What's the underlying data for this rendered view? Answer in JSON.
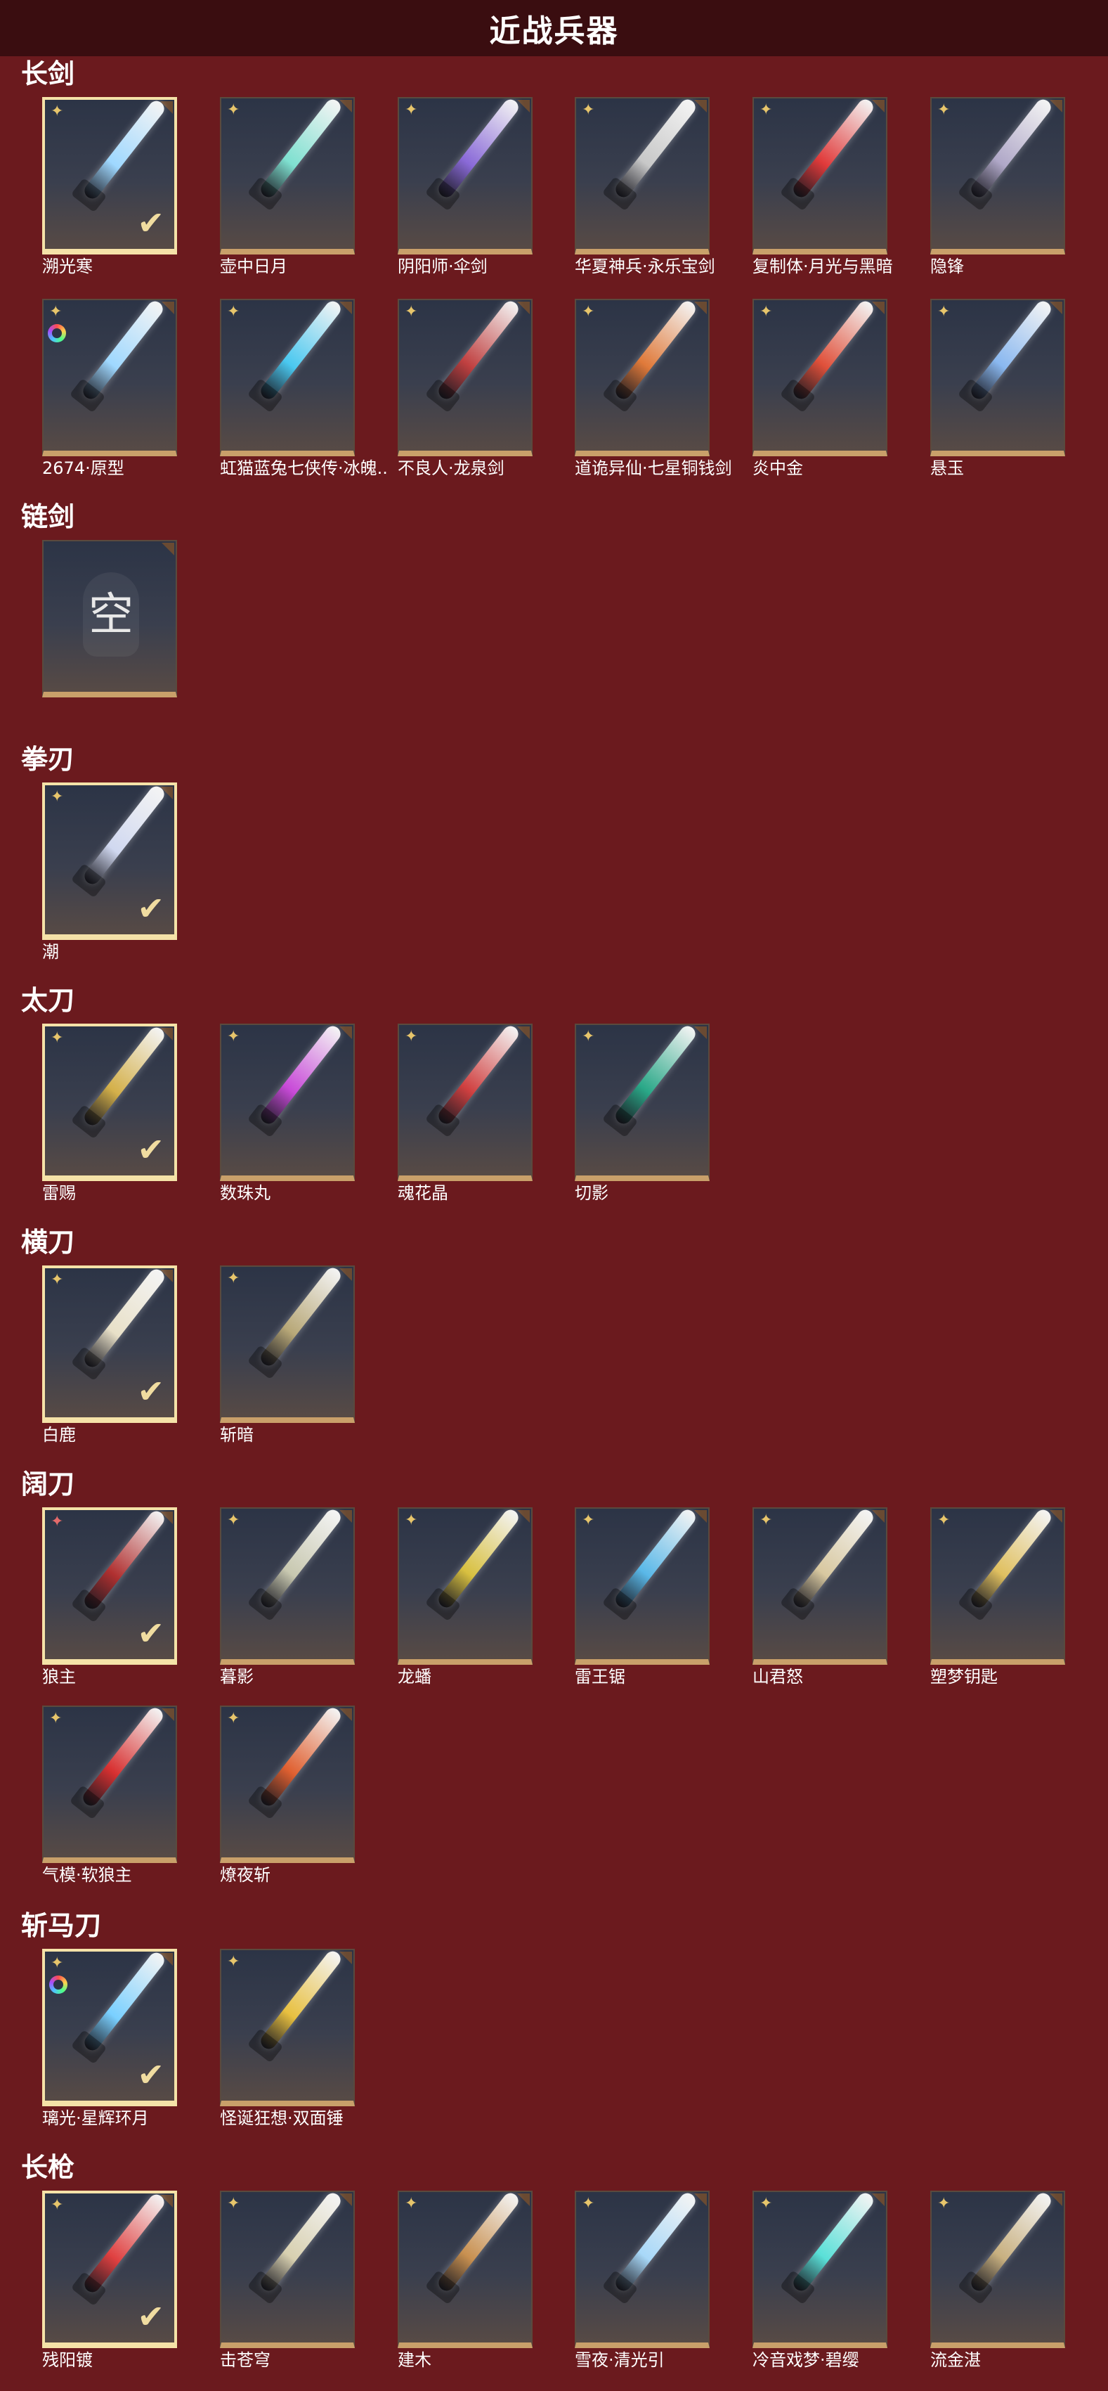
{
  "page_title": "近战兵器",
  "categories": [
    {
      "label": "长剑",
      "items": [
        {
          "name": "溯光寒",
          "selected": true,
          "marker": "star",
          "color": "#9fd8ff"
        },
        {
          "name": "壶中日月",
          "selected": false,
          "marker": "star",
          "color": "#7fe0d0"
        },
        {
          "name": "阴阳师·伞剑",
          "selected": false,
          "marker": "star",
          "color": "#8a6ad8"
        },
        {
          "name": "华夏神兵·永乐宝剑",
          "selected": false,
          "marker": "star",
          "color": "#c8c8c8"
        },
        {
          "name": "复制体·月光与黑暗",
          "selected": false,
          "marker": "star",
          "color": "#e03a3a"
        },
        {
          "name": "隐锋",
          "selected": false,
          "marker": "star",
          "color": "#b0a8c8"
        },
        {
          "name": "2674·原型",
          "selected": false,
          "marker": "star",
          "color": "#9fd8ff",
          "ring": true
        },
        {
          "name": "虹猫蓝兔七侠传·冰魄...",
          "selected": false,
          "marker": "star",
          "color": "#4ac8f0"
        },
        {
          "name": "不良人·龙泉剑",
          "selected": false,
          "marker": "star",
          "color": "#c04040"
        },
        {
          "name": "道诡异仙·七星铜钱剑",
          "selected": false,
          "marker": "star",
          "color": "#e07a3a"
        },
        {
          "name": "炎中金",
          "selected": false,
          "marker": "star",
          "color": "#e0503a"
        },
        {
          "name": "悬玉",
          "selected": false,
          "marker": "star",
          "color": "#8ab8f0"
        }
      ]
    },
    {
      "label": "链剑",
      "items": [
        {
          "name": "",
          "empty": true,
          "glyph": "空"
        }
      ]
    },
    {
      "label": "拳刃",
      "items": [
        {
          "name": "潮",
          "selected": true,
          "marker": "star",
          "color": "#d0d8f0"
        }
      ]
    },
    {
      "label": "太刀",
      "items": [
        {
          "name": "雷赐",
          "selected": true,
          "marker": "star",
          "color": "#d4b04a"
        },
        {
          "name": "数珠丸",
          "selected": false,
          "marker": "star",
          "color": "#c84ad8"
        },
        {
          "name": "魂花晶",
          "selected": false,
          "marker": "star",
          "color": "#d04040"
        },
        {
          "name": "切影",
          "selected": false,
          "marker": "star",
          "color": "#2aa888"
        }
      ]
    },
    {
      "label": "横刀",
      "items": [
        {
          "name": "白鹿",
          "selected": true,
          "marker": "star",
          "color": "#e8e0c8"
        },
        {
          "name": "斩暗",
          "selected": false,
          "marker": "star",
          "color": "#b8a878"
        }
      ]
    },
    {
      "label": "阔刀",
      "items": [
        {
          "name": "狼主",
          "selected": true,
          "marker": "star-red",
          "color": "#b03030"
        },
        {
          "name": "暮影",
          "selected": false,
          "marker": "star",
          "color": "#c8c8b0"
        },
        {
          "name": "龙蟠",
          "selected": false,
          "marker": "star",
          "color": "#d8c040"
        },
        {
          "name": "雷王锯",
          "selected": false,
          "marker": "star",
          "color": "#5ab8e8"
        },
        {
          "name": "山君怒",
          "selected": false,
          "marker": "star",
          "color": "#d8c8a0"
        },
        {
          "name": "塑梦钥匙",
          "selected": false,
          "marker": "star",
          "color": "#e0c060"
        },
        {
          "name": "气模·软狼主",
          "selected": false,
          "marker": "star",
          "color": "#d83030"
        },
        {
          "name": "燎夜斩",
          "selected": false,
          "marker": "star",
          "color": "#e06030"
        }
      ]
    },
    {
      "label": "斩马刀",
      "items": [
        {
          "name": "璃光·星辉环月",
          "selected": true,
          "marker": "star",
          "color": "#7ad0ff",
          "ring": true
        },
        {
          "name": "怪诞狂想·双面锤",
          "selected": false,
          "marker": "star",
          "color": "#e8c040"
        }
      ]
    },
    {
      "label": "长枪",
      "items": [
        {
          "name": "残阳镀",
          "selected": true,
          "marker": "star",
          "color": "#e04040"
        },
        {
          "name": "击苍穹",
          "selected": false,
          "marker": "star",
          "color": "#d8d0b0"
        },
        {
          "name": "建木",
          "selected": false,
          "marker": "star",
          "color": "#c89050"
        },
        {
          "name": "雪夜·清光引",
          "selected": false,
          "marker": "star",
          "color": "#a8d8f8"
        },
        {
          "name": "冷音戏梦·碧缨",
          "selected": false,
          "marker": "star",
          "color": "#5ae0d8"
        },
        {
          "name": "流金湛",
          "selected": false,
          "marker": "star",
          "color": "#c8b080"
        }
      ]
    }
  ]
}
